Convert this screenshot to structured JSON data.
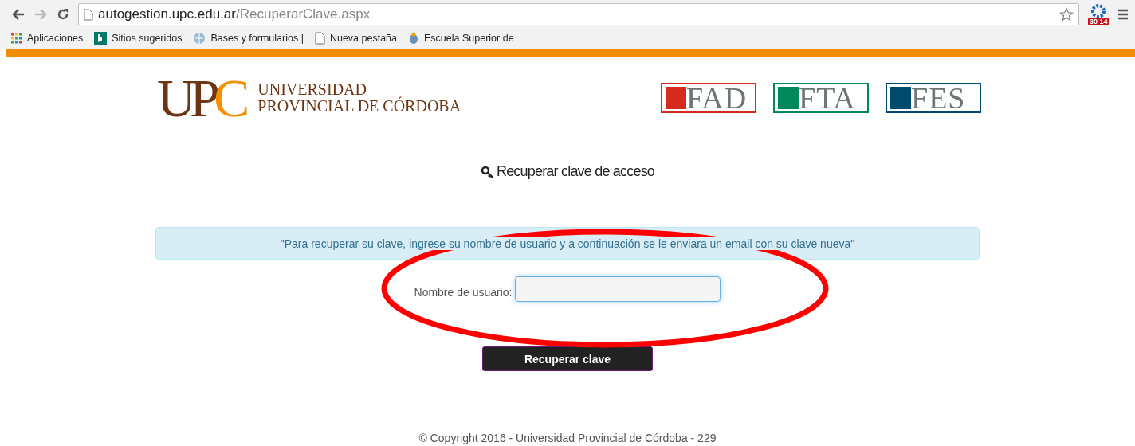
{
  "browser": {
    "url_host": "autogestion.upc.edu.ar",
    "url_path": "/RecuperarClave.aspx",
    "extension_badge": "30 14",
    "bookmarks": [
      {
        "kind": "apps",
        "label": "Aplicaciones"
      },
      {
        "kind": "bing",
        "label": "Sitios sugeridos"
      },
      {
        "kind": "globe",
        "label": "Bases y formularios |"
      },
      {
        "kind": "page",
        "label": "Nueva pestaña"
      },
      {
        "kind": "crest",
        "label": "Escuela Superior de"
      }
    ]
  },
  "header": {
    "logo": {
      "mark": "UPC",
      "line_1": "UNIVERSIDAD",
      "line_2": "PROVINCIAL DE CÓRDOBA"
    },
    "faculties": [
      {
        "label": "FAD",
        "color": "#d52b1e"
      },
      {
        "label": "FTA",
        "color": "#00875a"
      },
      {
        "label": "FES",
        "color": "#004a6e"
      }
    ]
  },
  "form": {
    "title": "Recuperar clave de acceso",
    "notice": "\"Para recuperar su clave, ingrese su nombre de usuario y a continuación se le enviara un email con su clave nueva\"",
    "username_label": "Nombre de usuario:",
    "submit": "Recuperar clave"
  },
  "footer": "© Copyright 2016 - Universidad Provincial de Córdoba - 229"
}
